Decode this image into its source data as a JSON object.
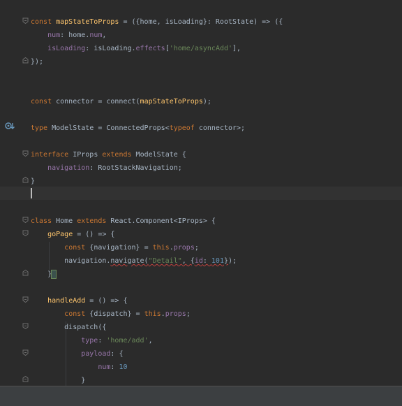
{
  "editor": {
    "lines": [
      "const mapStateToProps = ({home, isLoading}: RootState) => ({",
      "    num: home.num,",
      "    isLoading: isLoading.effects['home/asyncAdd'],",
      "});",
      "",
      "",
      "const connector = connect(mapStateToProps);",
      "",
      "type ModelState = ConnectedProps<typeof connector>;",
      "",
      "interface IProps extends ModelState {",
      "    navigation: RootStackNavigation;",
      "}",
      "",
      "",
      "",
      "class Home extends React.Component<IProps> {",
      "    goPage = () => {",
      "        const {navigation} = this.props;",
      "        navigation.navigate(\"Detail\", {id: 101});",
      "    }",
      "",
      "    handleAdd = () => {",
      "        const {dispatch} = this.props;",
      "        dispatch({",
      "            type: 'home/add',",
      "            payload: {",
      "                num: 10",
      "            }"
    ]
  },
  "gutter": {
    "icon": "implemented-interface-icon"
  },
  "colors": {
    "background": "#2b2b2b",
    "keyword": "#cc7832",
    "function": "#ffc66d",
    "property": "#9876aa",
    "string": "#6a8759",
    "number": "#6897bb",
    "text": "#a9b7c6"
  }
}
